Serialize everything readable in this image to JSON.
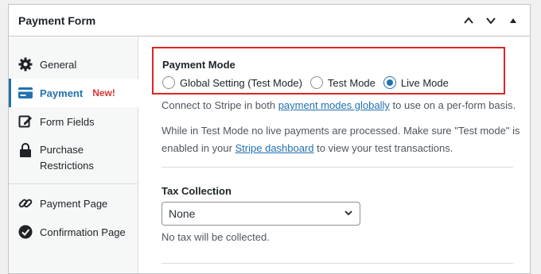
{
  "header": {
    "title": "Payment Form",
    "controls": [
      "chevron-up-icon",
      "chevron-down-icon",
      "triangle-up-icon"
    ]
  },
  "sidebar": {
    "items": [
      {
        "label": "General",
        "icon": "gear-icon"
      },
      {
        "label": "Payment",
        "icon": "credit-card-icon",
        "badge": "New!",
        "active": true
      },
      {
        "label": "Form Fields",
        "icon": "edit-icon"
      },
      {
        "label": "Purchase\nRestrictions",
        "icon": "lock-icon"
      },
      {
        "label": "Payment Page",
        "icon": "link-icon"
      },
      {
        "label": "Confirmation Page",
        "icon": "check-circle-icon"
      }
    ]
  },
  "payment_mode": {
    "label": "Payment Mode",
    "options": [
      {
        "label": "Global Setting (Test Mode)",
        "checked": false
      },
      {
        "label": "Test Mode",
        "checked": false
      },
      {
        "label": "Live Mode",
        "checked": true
      }
    ]
  },
  "info": {
    "line1_pre": "Connect to Stripe in both ",
    "line1_link": "payment modes globally",
    "line1_post": " to use on a per-form basis.",
    "line2": "While in Test Mode no live payments are processed. Make sure \"Test mode\" is",
    "line3_pre": "enabled in your ",
    "line3_link": "Stripe dashboard",
    "line3_post": " to view your test transactions."
  },
  "tax": {
    "label": "Tax Collection",
    "selected": "None",
    "note": "No tax will be collected."
  },
  "colors": {
    "accent": "#2271b1",
    "highlight_border": "#e02424",
    "badge": "#d63638"
  }
}
